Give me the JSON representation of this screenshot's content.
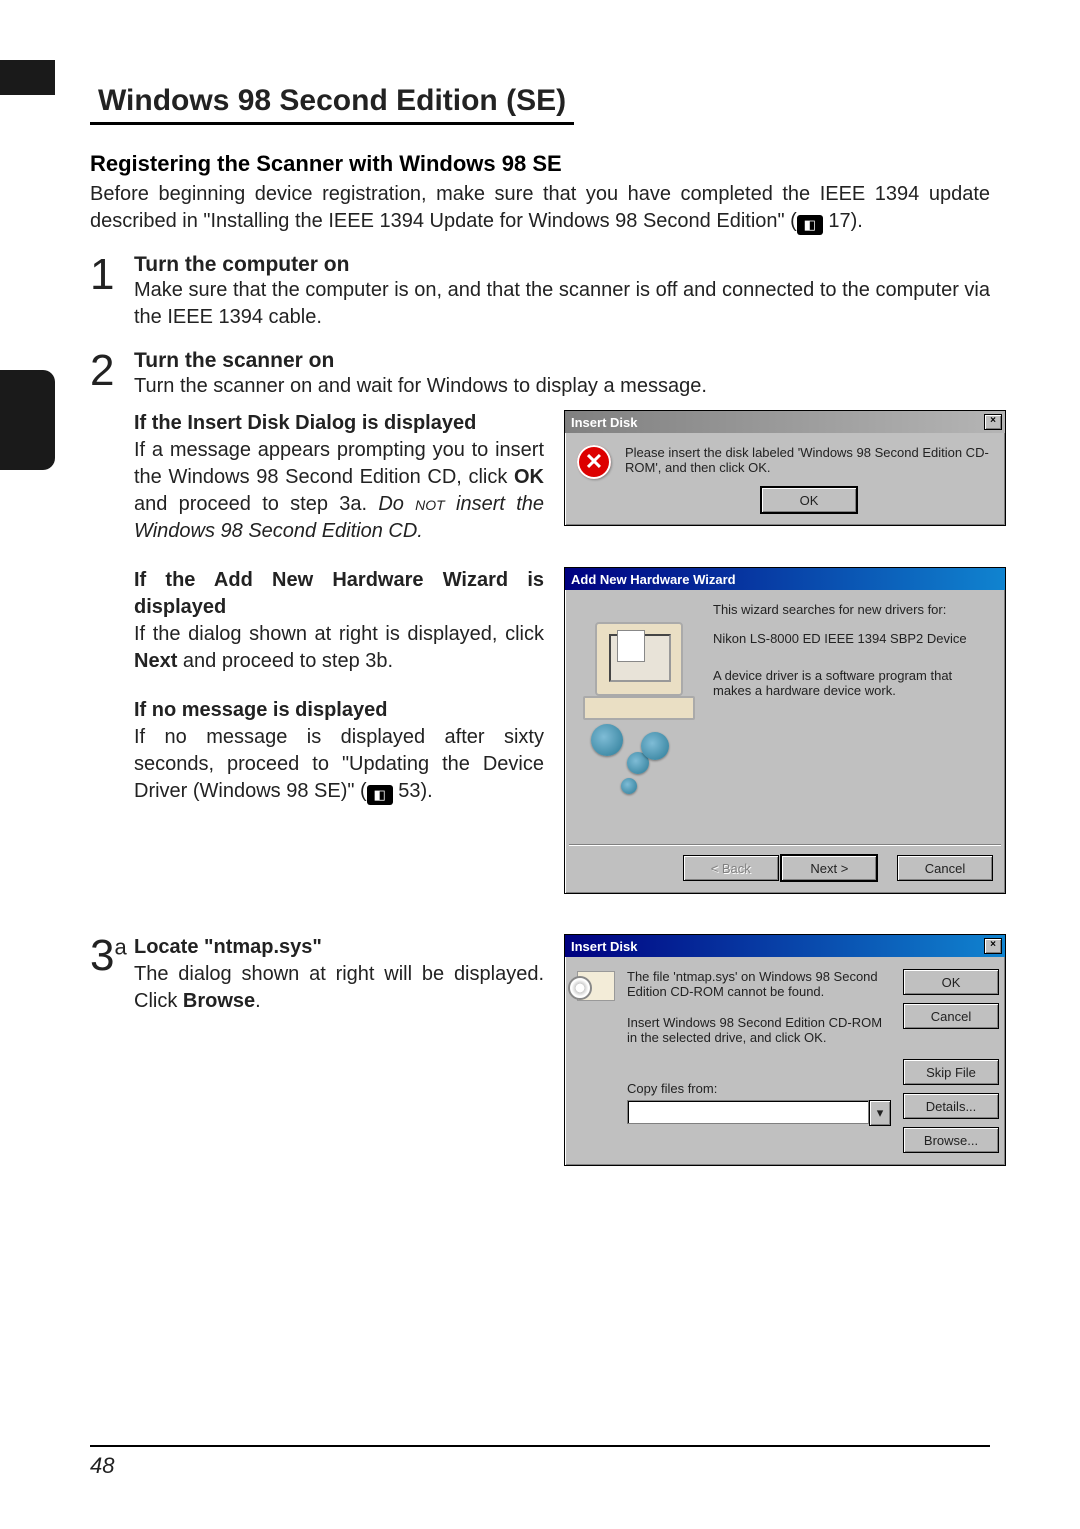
{
  "page": {
    "number": "48",
    "main_heading": "Windows 98 Second Edition (SE)",
    "sub_heading": "Registering the Scanner with Windows 98 SE",
    "intro_a": "Before beginning device registration, make sure that you have completed the IEEE 1394 update described in \"Installing the IEEE 1394 Update for Windows 98 Second Edition\" (",
    "intro_ref": " 17).",
    "steps": {
      "s1": {
        "num": "1",
        "title": "Turn the computer on",
        "body": "Make sure that the computer is on, and that the scanner is off and connected to the computer via the IEEE 1394 cable."
      },
      "s2": {
        "num": "2",
        "title": "Turn the scanner on",
        "body": "Turn the scanner on and wait for Windows to display a message."
      },
      "s2a": {
        "title": "If the Insert Disk Dialog is displayed",
        "body_a": "If a message appears prompting you to insert the Windows 98 Second Edition CD, click ",
        "bold1": "OK",
        "body_b": " and proceed to step 3a.  ",
        "italic_pre": "Do ",
        "smallcaps": "not",
        "italic_post": " insert the Windows 98 Second Edition CD."
      },
      "s2b": {
        "title": "If the Add New Hardware Wizard is displayed",
        "body_a": "If the dialog shown at right is displayed, click ",
        "bold1": "Next",
        "body_b": " and proceed to step 3b."
      },
      "s2c": {
        "title": "If no message is displayed",
        "body_a": "If no message is displayed after sixty seconds, proceed to \"Updating the Device Driver (Windows 98 SE)\" (",
        "ref": " 53)."
      },
      "s3a": {
        "num": "3",
        "sup": "a",
        "title": "Locate \"ntmap.sys\"",
        "body_a": "The dialog shown at right will be displayed.  Click ",
        "bold1": "Browse",
        "body_b": "."
      }
    }
  },
  "dlg_insert1": {
    "title": "Insert Disk",
    "msg": "Please insert the disk labeled 'Windows 98 Second Edition CD-ROM', and then click OK.",
    "ok": "OK"
  },
  "dlg_wizard": {
    "title": "Add New Hardware Wizard",
    "line1": "This wizard searches for new drivers for:",
    "device": "Nikon   LS-8000 ED       IEEE 1394 SBP2 Device",
    "line2": "A device driver is a software program that makes a hardware device work.",
    "back": "< Back",
    "next": "Next >",
    "cancel": "Cancel"
  },
  "dlg_insert2": {
    "title": "Insert Disk",
    "msg1": "The file 'ntmap.sys' on Windows 98 Second Edition CD-ROM cannot be found.",
    "msg2": "Insert Windows 98 Second Edition CD-ROM in the selected drive, and click OK.",
    "copy_label": "Copy files from:",
    "ok": "OK",
    "cancel": "Cancel",
    "skip": "Skip File",
    "details": "Details...",
    "browse": "Browse..."
  }
}
